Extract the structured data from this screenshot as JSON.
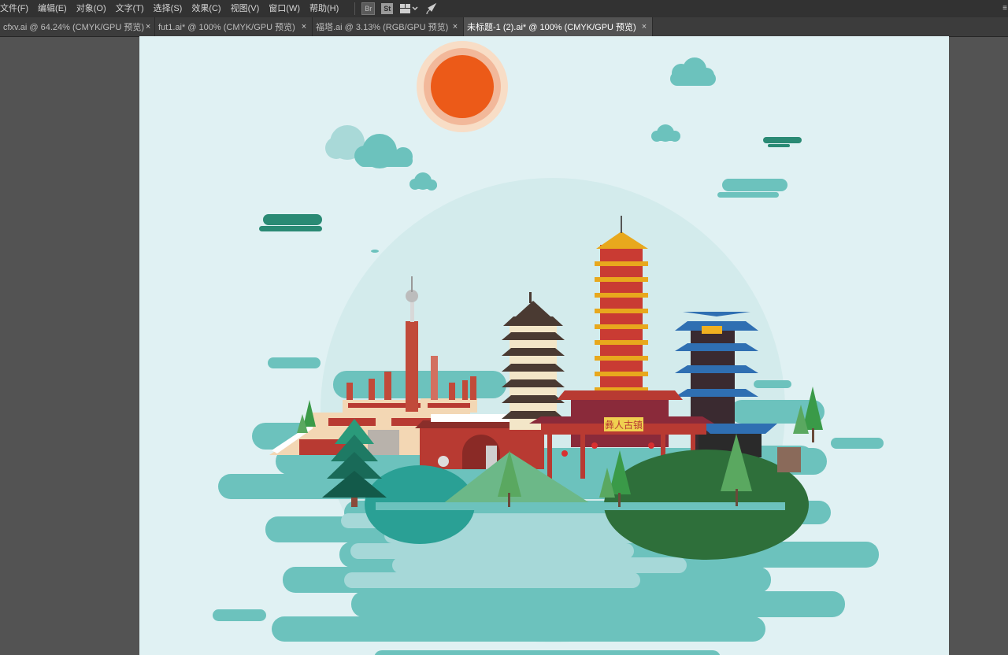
{
  "menu": {
    "items": [
      "文件(F)",
      "编辑(E)",
      "对象(O)",
      "文字(T)",
      "选择(S)",
      "效果(C)",
      "视图(V)",
      "窗口(W)",
      "帮助(H)"
    ],
    "br_label": "Br",
    "st_label": "St"
  },
  "tabs": [
    {
      "label": "cfxv.ai @ 64.24% (CMYK/GPU 预览)",
      "close": "×"
    },
    {
      "label": "fut1.ai* @ 100% (CMYK/GPU 预览)",
      "close": "×"
    },
    {
      "label": "福塔.ai @ 3.13% (RGB/GPU 预览)",
      "close": "×"
    },
    {
      "label": "未标题-1 (2).ai* @ 100% (CMYK/GPU 预览)",
      "close": "×"
    }
  ],
  "artwork": {
    "gate_plaque": "彝人古镇",
    "colors": {
      "background": "#e0f1f3",
      "sun": "#ec5a18",
      "cloud": "#6cc2bd",
      "dark_cloud": "#2a8a74",
      "water_light": "#a6d8d8",
      "red_building": "#b83a32",
      "pagoda_gold": "#e8a81d",
      "tower_blue": "#2f6fb2",
      "hill_green": "#2e6f3a"
    }
  }
}
